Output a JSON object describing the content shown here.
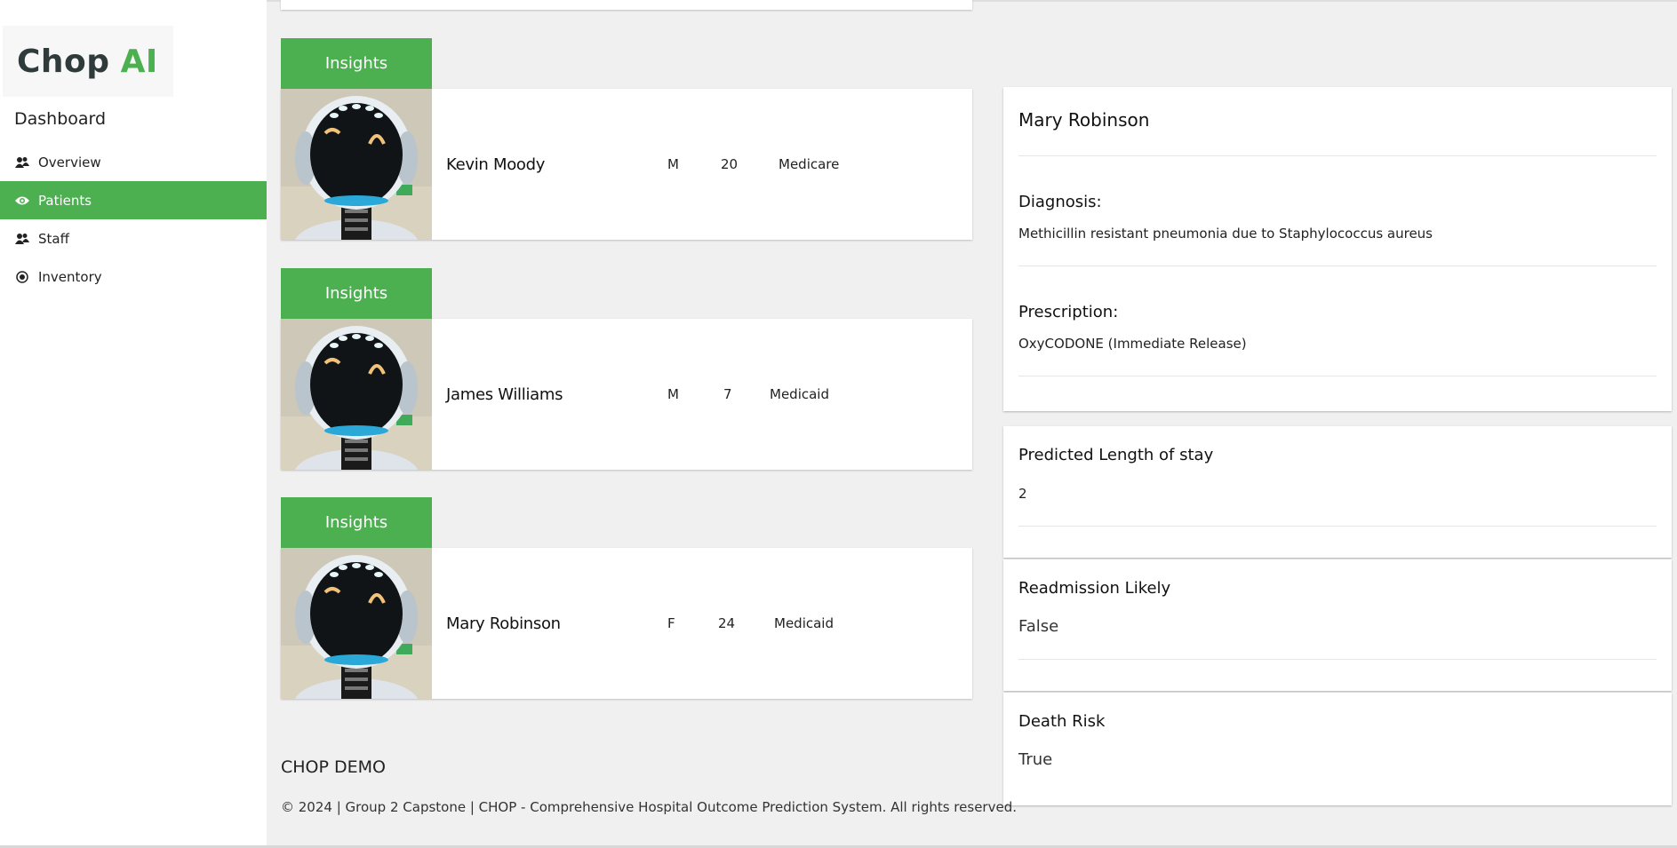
{
  "brand": {
    "name": "Chop",
    "suffix": "AI"
  },
  "sidebar": {
    "title": "Dashboard",
    "items": [
      {
        "label": "Overview",
        "icon": "users-icon",
        "active": false
      },
      {
        "label": "Patients",
        "icon": "eye-icon",
        "active": true
      },
      {
        "label": "Staff",
        "icon": "users-icon",
        "active": false
      },
      {
        "label": "Inventory",
        "icon": "target-icon",
        "active": false
      }
    ]
  },
  "patients": [
    {
      "insights_label": "Insights",
      "name": "Kevin Moody",
      "sex": "M",
      "age": "20",
      "insurance": "Medicare"
    },
    {
      "insights_label": "Insights",
      "name": "James Williams",
      "sex": "M",
      "age": "7",
      "insurance": "Medicaid"
    },
    {
      "insights_label": "Insights",
      "name": "Mary Robinson",
      "sex": "F",
      "age": "24",
      "insurance": "Medicaid"
    }
  ],
  "details": {
    "name": "Mary Robinson",
    "diagnosis_label": "Diagnosis:",
    "diagnosis": "Methicillin resistant pneumonia due to Staphylococcus aureus",
    "prescription_label": "Prescription:",
    "prescription": "OxyCODONE (Immediate Release)"
  },
  "predictions": {
    "los_label": "Predicted Length of stay",
    "los_value": "2",
    "readmission_label": "Readmission Likely",
    "readmission_value": "False",
    "death_label": "Death Risk",
    "death_value": "True"
  },
  "footer": {
    "title": "CHOP DEMO",
    "copyright": "© 2024 | Group 2 Capstone | CHOP - Comprehensive Hospital Outcome Prediction System. All rights reserved."
  },
  "colors": {
    "accent": "#4caf50",
    "background": "#f0f0f0"
  }
}
